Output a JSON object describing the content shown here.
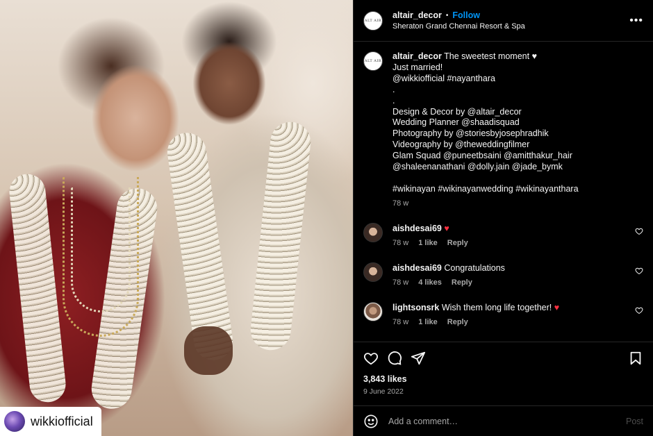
{
  "media": {
    "tag_username": "wikkiofficial"
  },
  "header": {
    "username": "altair_decor",
    "separator": "•",
    "follow_label": "Follow",
    "location": "Sheraton Grand Chennai Resort & Spa",
    "logo_text": "ALT AIR",
    "more_label": "•••"
  },
  "caption": {
    "username": "altair_decor",
    "lines": [
      "The sweetest moment ♥",
      "Just married!",
      "@wikkiofficial #nayanthara",
      ".",
      ".",
      "Design & Decor by @altair_decor",
      "Wedding Planner @shaadisquad",
      "Photography by @storiesbyjosephradhik",
      "Videography by @theweddingfilmer",
      "Glam Squad @puneetbsaini @amitthakur_hair",
      "@shaleenanathani @dolly.jain @jade_bymk",
      "",
      "#wikinayan #wikinayanwedding #wikinayanthara"
    ],
    "age": "78 w"
  },
  "comments": [
    {
      "username": "aishdesai69",
      "text": "",
      "emoji": "♥",
      "age": "78 w",
      "likes": "1 like",
      "reply": "Reply"
    },
    {
      "username": "aishdesai69",
      "text": "Congratulations",
      "emoji": "",
      "age": "78 w",
      "likes": "4 likes",
      "reply": "Reply"
    },
    {
      "username": "lightsonsrk",
      "text": "Wish them long life together!",
      "emoji": "♥",
      "age": "78 w",
      "likes": "1 like",
      "reply": "Reply"
    }
  ],
  "footer": {
    "likes": "3,843 likes",
    "date": "9 June 2022",
    "comment_placeholder": "Add a comment…",
    "post_label": "Post"
  },
  "colors": {
    "follow": "#0095f6",
    "heart": "#ff3040",
    "background": "#000000"
  }
}
